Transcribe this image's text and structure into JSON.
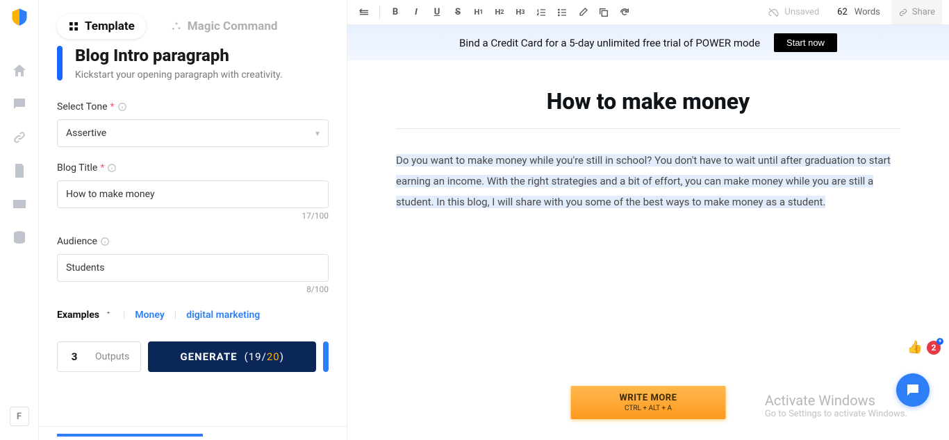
{
  "rail": {
    "bottom_letter": "F"
  },
  "tabs": {
    "template": "Template",
    "magic": "Magic Command"
  },
  "banner": {
    "title": "Blog Intro paragraph",
    "desc": "Kickstart your opening paragraph with creativity."
  },
  "form": {
    "tone_label": "Select Tone",
    "tone_value": "Assertive",
    "title_label": "Blog Title",
    "title_value": "How to make money",
    "title_counter": "17/100",
    "audience_label": "Audience",
    "audience_value": "Students",
    "audience_counter": "8/100"
  },
  "examples": {
    "label": "Examples",
    "items": [
      "Money",
      "digital marketing"
    ]
  },
  "generate": {
    "outputs_value": "3",
    "outputs_label": "Outputs",
    "button": "GENERATE",
    "used": "19",
    "total": "20"
  },
  "toolbar": {
    "save_status": "Unsaved",
    "word_count": "62",
    "word_label": "Words",
    "share": "Share"
  },
  "promo": {
    "text": "Bind a Credit Card for a 5-day unlimited free trial of POWER mode",
    "cta": "Start now"
  },
  "doc": {
    "title": "How to make money",
    "body": "Do you want to make money while you're still in school? You don't have to wait until after graduation to start earning an income. With the right strategies and a bit of effort, you can make money while you are still a student. In this blog, I will share with you some of the best ways to make money as a student."
  },
  "write_more": {
    "main": "WRITE MORE",
    "sub": "CTRL + ALT + A"
  },
  "watermark": {
    "line1": "Activate Windows",
    "line2": "Go to Settings to activate Windows."
  },
  "feedback": {
    "badge": "2"
  }
}
